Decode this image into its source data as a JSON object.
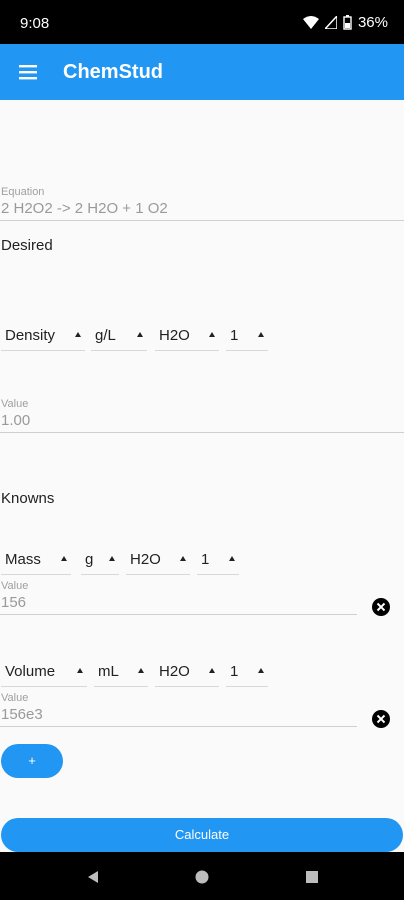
{
  "status": {
    "time": "9:08",
    "battery": "36%"
  },
  "appbar": {
    "title": "ChemStud"
  },
  "equation": {
    "label": "Equation",
    "value": "2 H2O2 -> 2 H2O + 1 O2"
  },
  "desired": {
    "heading": "Desired",
    "dropdowns": [
      "Density",
      "g/L",
      "H2O",
      "1"
    ],
    "value_label": "Value",
    "value": "1.00"
  },
  "knowns": {
    "heading": "Knowns",
    "rows": [
      {
        "dropdowns": [
          "Mass",
          "g",
          "H2O",
          "1"
        ],
        "value_label": "Value",
        "value": "156"
      },
      {
        "dropdowns": [
          "Volume",
          "mL",
          "H2O",
          "1"
        ],
        "value_label": "Value",
        "value": "156e3"
      }
    ]
  },
  "buttons": {
    "add": "+",
    "calculate": "Calculate"
  }
}
